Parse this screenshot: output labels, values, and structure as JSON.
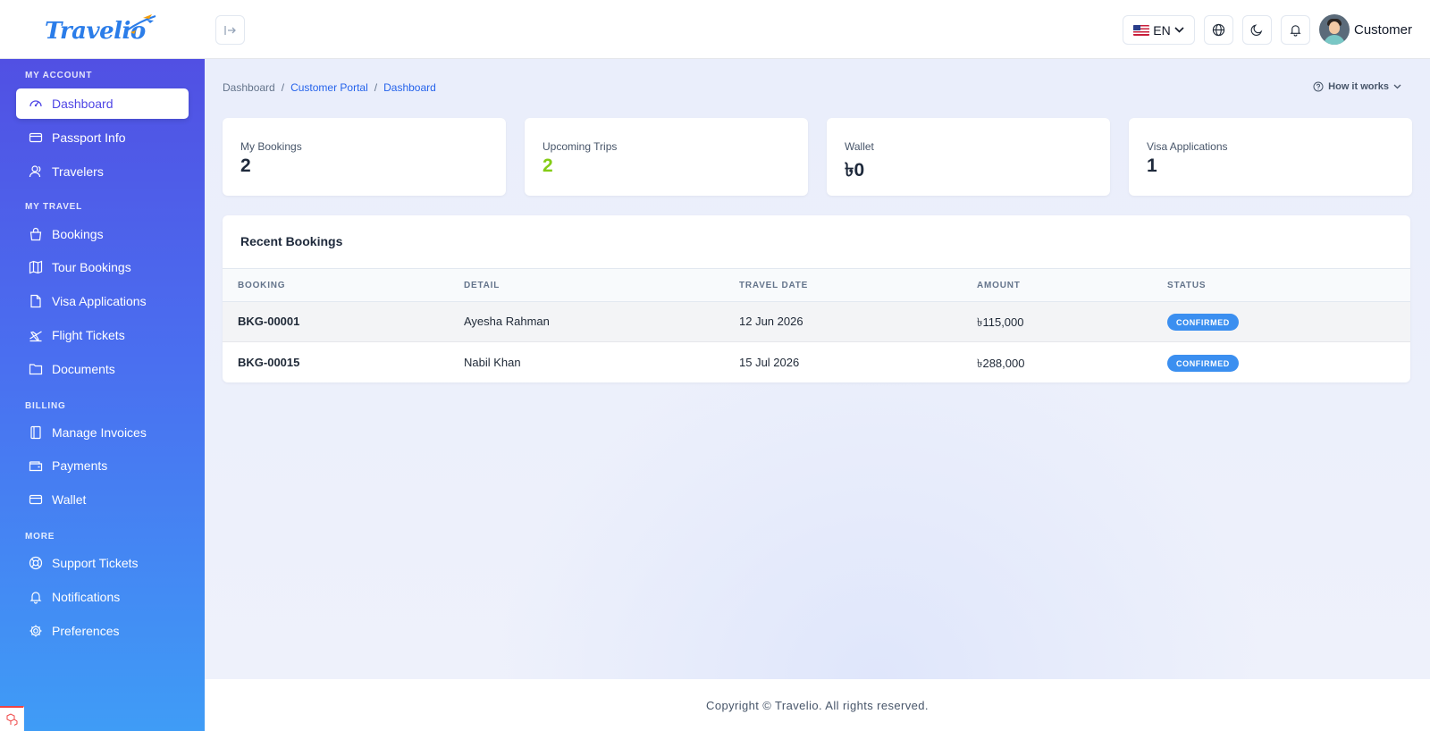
{
  "brand": {
    "name": "Travelio"
  },
  "header": {
    "language": "EN",
    "user_name": "Customer"
  },
  "sidebar": {
    "sections": [
      {
        "title": "MY ACCOUNT",
        "items": [
          {
            "label": "Dashboard",
            "icon": "gauge-icon",
            "active": true
          },
          {
            "label": "Passport Info",
            "icon": "card-icon"
          },
          {
            "label": "Travelers",
            "icon": "users-icon"
          }
        ]
      },
      {
        "title": "MY TRAVEL",
        "items": [
          {
            "label": "Bookings",
            "icon": "bag-icon"
          },
          {
            "label": "Tour Bookings",
            "icon": "map-icon"
          },
          {
            "label": "Visa Applications",
            "icon": "file-icon"
          },
          {
            "label": "Flight Tickets",
            "icon": "plane-icon"
          },
          {
            "label": "Documents",
            "icon": "folder-icon"
          }
        ]
      },
      {
        "title": "BILLING",
        "items": [
          {
            "label": "Manage Invoices",
            "icon": "invoice-icon"
          },
          {
            "label": "Payments",
            "icon": "wallet-icon"
          },
          {
            "label": "Wallet",
            "icon": "card-icon"
          }
        ]
      },
      {
        "title": "MORE",
        "items": [
          {
            "label": "Support Tickets",
            "icon": "lifebuoy-icon"
          },
          {
            "label": "Notifications",
            "icon": "bell-icon"
          },
          {
            "label": "Preferences",
            "icon": "gear-icon"
          }
        ]
      }
    ]
  },
  "breadcrumb": [
    "Dashboard",
    "Customer Portal",
    "Dashboard"
  ],
  "how_it_works": "How it works",
  "stats": [
    {
      "label": "My Bookings",
      "value": "2"
    },
    {
      "label": "Upcoming Trips",
      "value": "2"
    },
    {
      "label": "Wallet",
      "value": "৳0"
    },
    {
      "label": "Visa Applications",
      "value": "1"
    }
  ],
  "recent_bookings": {
    "title": "Recent Bookings",
    "columns": [
      "BOOKING",
      "DETAIL",
      "TRAVEL DATE",
      "AMOUNT",
      "STATUS"
    ],
    "rows": [
      {
        "booking": "BKG-00001",
        "detail": "Ayesha Rahman",
        "date": "12 Jun 2026",
        "amount": "৳115,000",
        "status": "CONFIRMED"
      },
      {
        "booking": "BKG-00015",
        "detail": "Nabil Khan",
        "date": "15 Jul 2026",
        "amount": "৳288,000",
        "status": "CONFIRMED"
      }
    ]
  },
  "footer": {
    "text": "Copyright © Travelio. All rights reserved."
  },
  "colors": {
    "accent": "#4f46e5",
    "link": "#2563eb",
    "badge": "#3b8ff0",
    "positive": "#84cc16"
  }
}
